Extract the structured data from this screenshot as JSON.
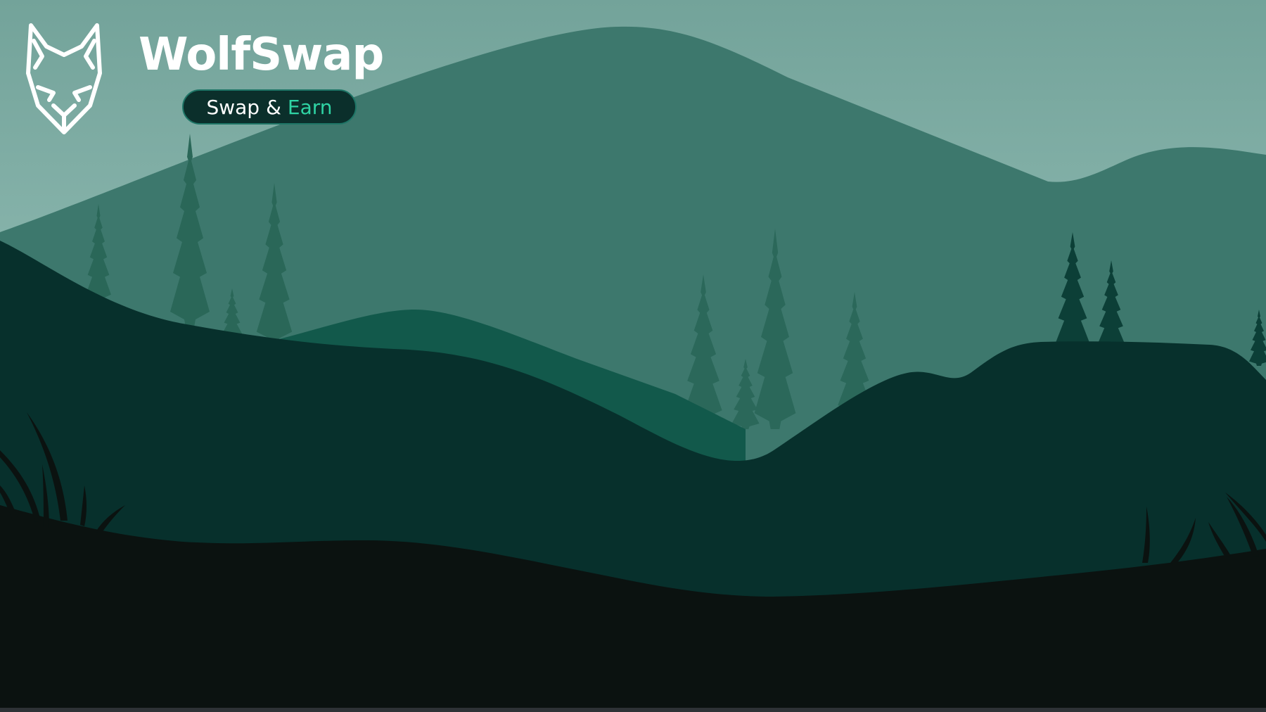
{
  "brand": {
    "name": "WolfSwap",
    "tagline_part1": "Swap",
    "tagline_amp": "&",
    "tagline_accent": "Earn",
    "logo_icon": "wolf-head-outline-icon"
  },
  "colors": {
    "sky_top": "#73a39a",
    "sky_bottom": "#a6cdc6",
    "far_mountain": "#3d786d",
    "far_trees": "#2a6758",
    "mid_hill": "#12594b",
    "near_hill": "#07302c",
    "ground": "#0b1210",
    "accent": "#2fd4a4",
    "pill_background": "#0b2f2b"
  }
}
